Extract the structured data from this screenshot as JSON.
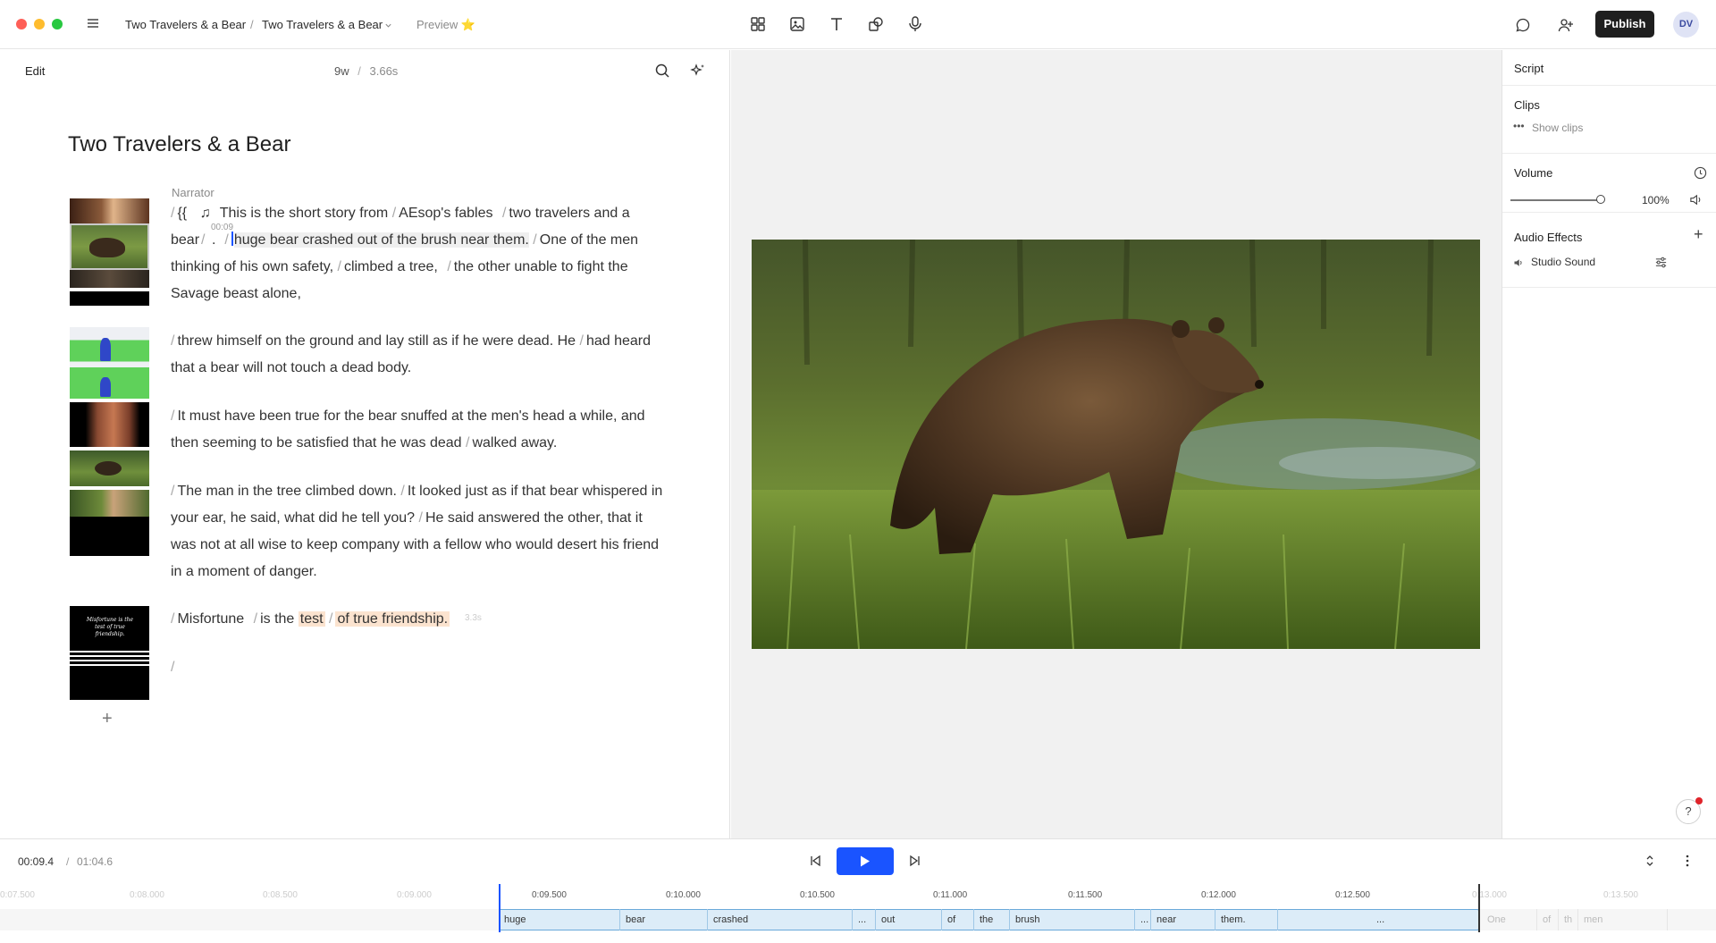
{
  "topbar": {
    "breadcrumb_project": "Two Travelers & a Bear",
    "breadcrumb_separator": "/",
    "breadcrumb_composition": "Two Travelers & a Bear",
    "preview_label": "Preview ⭐",
    "publish_label": "Publish",
    "avatar_initials": "DV"
  },
  "editor": {
    "mode_label": "Edit",
    "word_count": "9w",
    "stats_separator": "/",
    "selection_duration": "3.66s",
    "document_title": "Two Travelers & a Bear",
    "speaker": "Narrator",
    "timestamp_marker": "00:09",
    "end_marker": "3.3s",
    "music_glyph": "♫",
    "paragraphs": {
      "p1_a": "{{",
      "p1_b": "This is the short story from",
      "p1_c": "AEsop's fables",
      "p1_d": "two travelers and a bear",
      "p1_e": ".",
      "p1_f": "huge bear crashed out of the brush near them.",
      "p1_g": "One of the men thinking of his own safety,",
      "p1_h": "climbed a tree,",
      "p1_i": "the other unable to fight the Savage beast alone,",
      "p2_a": "threw himself on the ground and lay still as if he were dead. He",
      "p2_b": "had heard that a bear will not touch a dead body.",
      "p3_a": "It must have been true for the bear snuffed at the men's head a while, and then seeming to be satisfied that he was dead",
      "p3_b": "walked away.",
      "p4_a": "The man in the tree climbed down.",
      "p4_b": "It looked just as if that bear whispered in your ear, he said, what did he tell you?",
      "p4_c": "He said answered the other, that it was not at all wise to keep company with a fellow who would desert his friend in a moment of danger.",
      "p5_a": "Misfortune",
      "p5_b": "is the",
      "p5_c": "test",
      "p5_d": "of true friendship.",
      "p6": "/"
    },
    "slash": "/",
    "add_scene": "+",
    "title_card_text": "Misfortune is the test of true friendship."
  },
  "sidebar": {
    "script_label": "Script",
    "clips_label": "Clips",
    "show_clips": "Show clips",
    "volume_label": "Volume",
    "volume_value": "100%",
    "volume_level": 1.0,
    "audio_effects_label": "Audio Effects",
    "studio_sound_label": "Studio Sound",
    "help": "?"
  },
  "transport": {
    "current_time": "00:09.4",
    "time_separator": "/",
    "total_time": "01:04.6"
  },
  "timeline": {
    "ticks": [
      "0:09.500",
      "0:10.000",
      "0:10.500",
      "0:11.000",
      "0:11.500",
      "0:12.000",
      "0:12.500"
    ],
    "faded_ticks": [
      "0:07.500",
      "0:08.000",
      "0:08.500",
      "0:09.000",
      "0:13.000",
      "0:13.500"
    ],
    "words": [
      "huge",
      "bear",
      "crashed",
      "...",
      "out",
      "of",
      "the",
      "brush",
      "...",
      "near",
      "them.",
      "..."
    ],
    "faded_words": [
      "One",
      "of",
      "th",
      "men"
    ]
  },
  "colors": {
    "accent": "#1a54ff",
    "publish_bg": "#1f1f1f",
    "highlight_orange": "#fbe3cf",
    "clip_blue": "#dcecf8"
  }
}
